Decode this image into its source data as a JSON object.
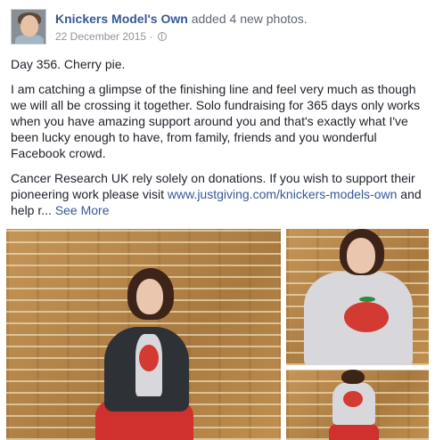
{
  "post": {
    "author": "Knickers Model's Own",
    "action": "added 4 new photos.",
    "date": "22 December 2015",
    "separator": "·",
    "privacy_icon": "globe-icon",
    "paragraphs": {
      "p1": "Day 356. Cherry pie.",
      "p2": "I am catching a glimpse of the finishing line and feel very much as though we will all be crossing it together. Solo fundraising for 365 days only works when you have amazing support around you and that's exactly what I've been lucky enough to have, from family, friends and you wonderful Facebook crowd.",
      "p3_prefix": "Cancer Research UK rely solely on donations. If you wish to support their pioneering work please visit ",
      "p3_link": "www.justgiving.com/knickers-models-own",
      "p3_suffix": " and help r...",
      "see_more": "See More"
    }
  },
  "colors": {
    "link": "#365899",
    "meta": "#90949c",
    "text": "#1d2129"
  }
}
